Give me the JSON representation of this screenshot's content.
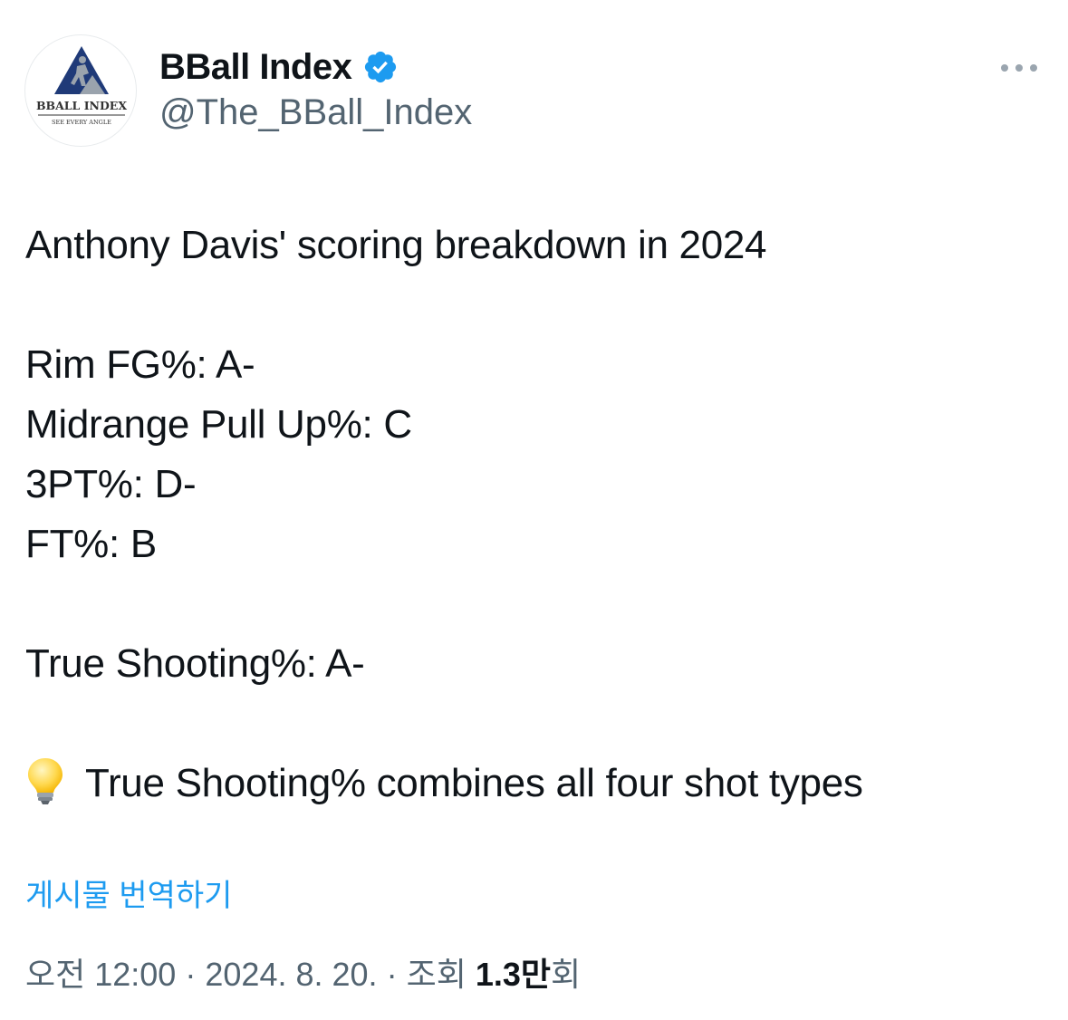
{
  "author": {
    "display_name": "BBall Index",
    "handle": "@The_BBall_Index",
    "verified_icon": "verified-badge-icon",
    "verified_color": "#1d9bf0",
    "avatar_logo_text": "BBALL INDEX",
    "avatar_logo_tagline": "SEE EVERY ANGLE"
  },
  "more_icon": "more-horizontal-icon",
  "tweet": {
    "lines": {
      "title": "Anthony Davis' scoring breakdown in 2024",
      "rim": "Rim FG%: A-",
      "midrange": "Midrange Pull Up%: C",
      "three": "3PT%: D-",
      "ft": "FT%: B",
      "ts": "True Shooting%: A-",
      "note": "True Shooting% combines all four shot types"
    },
    "note_icon": "lightbulb-icon"
  },
  "translate_label": "게시물 번역하기",
  "meta": {
    "time": "오전 12:00",
    "separator": "·",
    "date": "2024. 8. 20.",
    "views_label": "조회",
    "views_count": "1.3",
    "views_unit_bold": "만",
    "views_suffix": "회"
  },
  "colors": {
    "text": "#0f1419",
    "secondary": "#536471",
    "link": "#1d9bf0"
  }
}
